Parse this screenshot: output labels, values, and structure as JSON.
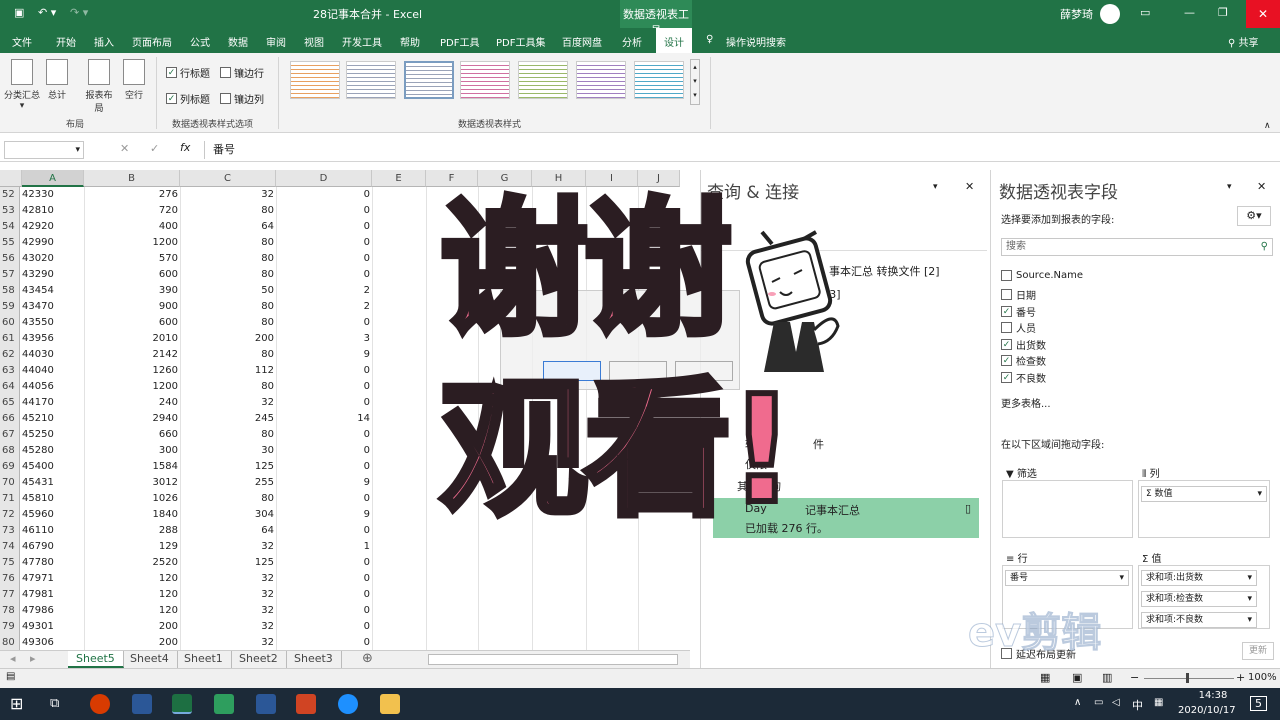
{
  "window": {
    "title": "28记事本合并 - Excel",
    "context_tab": "数据透视表工具",
    "user": "薛梦琦",
    "share": "共享"
  },
  "tabs": [
    "文件",
    "开始",
    "插入",
    "页面布局",
    "公式",
    "数据",
    "审阅",
    "视图",
    "开发工具",
    "帮助",
    "PDF工具",
    "PDF工具集",
    "百度网盘",
    "分析",
    "设计"
  ],
  "tell_me": "操作说明搜索",
  "ribbon": {
    "layout_buttons": [
      "分类汇总",
      "总计",
      "报表布局",
      "空行"
    ],
    "layout_group": "布局",
    "options": [
      {
        "label": "行标题",
        "checked": true
      },
      {
        "label": "镶边行",
        "checked": false
      },
      {
        "label": "列标题",
        "checked": true
      },
      {
        "label": "镶边列",
        "checked": false
      }
    ],
    "options_group": "数据透视表样式选项",
    "styles_group": "数据透视表样式"
  },
  "formula": {
    "fx": "fx",
    "value": "番号"
  },
  "columns": [
    "A",
    "B",
    "C",
    "D",
    "E",
    "F",
    "G",
    "H",
    "I",
    "J"
  ],
  "rows": [
    [
      "52",
      "42330",
      "276",
      "32",
      "0"
    ],
    [
      "53",
      "42810",
      "720",
      "80",
      "0"
    ],
    [
      "54",
      "42920",
      "400",
      "64",
      "0"
    ],
    [
      "55",
      "42990",
      "1200",
      "80",
      "0"
    ],
    [
      "56",
      "43020",
      "570",
      "80",
      "0"
    ],
    [
      "57",
      "43290",
      "600",
      "80",
      "0"
    ],
    [
      "58",
      "43454",
      "390",
      "50",
      "2"
    ],
    [
      "59",
      "43470",
      "900",
      "80",
      "2"
    ],
    [
      "60",
      "43550",
      "600",
      "80",
      "0"
    ],
    [
      "61",
      "43956",
      "2010",
      "200",
      "3"
    ],
    [
      "62",
      "44030",
      "2142",
      "80",
      "9"
    ],
    [
      "63",
      "44040",
      "1260",
      "112",
      "0"
    ],
    [
      "64",
      "44056",
      "1200",
      "80",
      "0"
    ],
    [
      "65",
      "44170",
      "240",
      "32",
      "0"
    ],
    [
      "66",
      "45210",
      "2940",
      "245",
      "14"
    ],
    [
      "67",
      "45250",
      "660",
      "80",
      "0"
    ],
    [
      "68",
      "45280",
      "300",
      "30",
      "0"
    ],
    [
      "69",
      "45400",
      "1584",
      "125",
      "0"
    ],
    [
      "70",
      "45431",
      "3012",
      "255",
      "9"
    ],
    [
      "71",
      "45810",
      "1026",
      "80",
      "0"
    ],
    [
      "72",
      "45960",
      "1840",
      "304",
      "9"
    ],
    [
      "73",
      "46110",
      "288",
      "64",
      "0"
    ],
    [
      "74",
      "46790",
      "129",
      "32",
      "1"
    ],
    [
      "75",
      "47780",
      "2520",
      "125",
      "0"
    ],
    [
      "76",
      "47971",
      "120",
      "32",
      "0"
    ],
    [
      "77",
      "47981",
      "120",
      "32",
      "0"
    ],
    [
      "78",
      "47986",
      "120",
      "32",
      "0"
    ],
    [
      "79",
      "49301",
      "200",
      "32",
      "0"
    ],
    [
      "80",
      "49306",
      "200",
      "32",
      "0"
    ]
  ],
  "sheets": [
    "Sheet5",
    "Sheet4",
    "Sheet1",
    "Sheet2",
    "Sheet3"
  ],
  "query_pane": {
    "title": "查询 & 连接",
    "items": [
      "事本汇总 转换文件 [2]",
      "[3]",
      "转",
      "仅限",
      "转换",
      "件",
      "仅限",
      "其他查询",
      "Day",
      "记事本汇总",
      "已加载 276 行。"
    ]
  },
  "fields_pane": {
    "title": "数据透视表字段",
    "choose": "选择要添加到报表的字段:",
    "search": "搜索",
    "fields": [
      {
        "label": "Source.Name",
        "checked": false
      },
      {
        "label": "日期",
        "checked": false
      },
      {
        "label": "番号",
        "checked": true
      },
      {
        "label": "人员",
        "checked": false
      },
      {
        "label": "出货数",
        "checked": true
      },
      {
        "label": "检查数",
        "checked": true
      },
      {
        "label": "不良数",
        "checked": true
      }
    ],
    "more": "更多表格...",
    "drag": "在以下区域间拖动字段:",
    "filter": "筛选",
    "cols": "列",
    "rowsl": "行",
    "vals": "值",
    "col_item": "Σ 数值",
    "row_item": "番号",
    "val_items": [
      "求和项:出货数",
      "求和项:检查数",
      "求和项:不良数"
    ],
    "defer": "延迟布局更新",
    "update": "更新"
  },
  "status": {
    "zoom": "100%"
  },
  "clock": {
    "time": "14:38",
    "date": "2020/10/17",
    "lang": "中",
    "notif": "5"
  },
  "overlay": {
    "line1": "谢谢",
    "line2": "观看!",
    "watermark": "ev剪辑"
  }
}
